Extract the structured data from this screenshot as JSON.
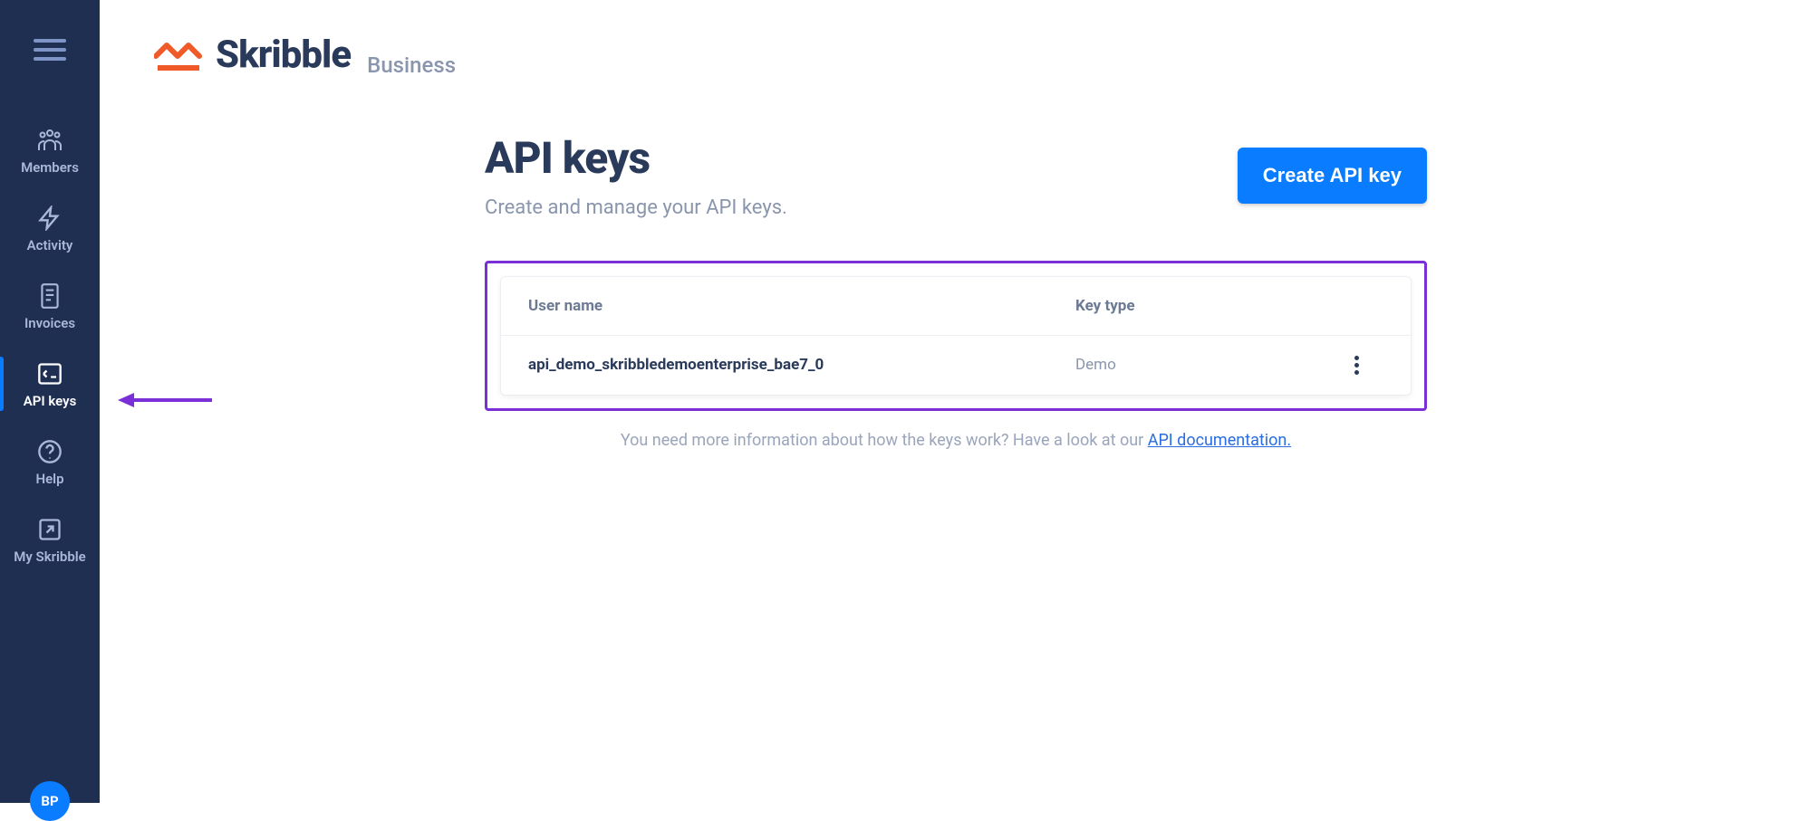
{
  "brand": {
    "name": "Skribble",
    "sub": "Business"
  },
  "sidebar": {
    "items": [
      {
        "label": "Members"
      },
      {
        "label": "Activity"
      },
      {
        "label": "Invoices"
      },
      {
        "label": "API keys"
      },
      {
        "label": "Help"
      },
      {
        "label": "My Skribble"
      }
    ],
    "avatar": "BP"
  },
  "page": {
    "title": "API keys",
    "subtitle": "Create and manage your API keys.",
    "create_button": "Create API key",
    "hint_prefix": "You need more information about how the keys work? Have a look at our ",
    "hint_link": "API documentation."
  },
  "table": {
    "headers": {
      "username": "User name",
      "keytype": "Key type"
    },
    "rows": [
      {
        "username": "api_demo_skribbledemoenterprise_bae7_0",
        "keytype": "Demo"
      }
    ]
  }
}
